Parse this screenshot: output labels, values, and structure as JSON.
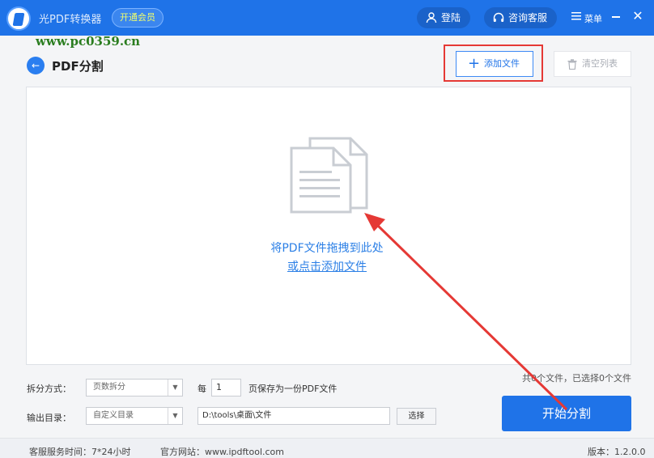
{
  "titlebar": {
    "app_title": "光PDF转换器",
    "vip_label": "开通会员",
    "login_label": "登陆",
    "service_label": "咨询客服",
    "menu_label": "菜单"
  },
  "watermark": "www.pc0359.cn",
  "page": {
    "title": "PDF分割",
    "add_file_label": "添加文件",
    "clear_list_label": "清空列表"
  },
  "drop_zone": {
    "hint": "将PDF文件拖拽到此处",
    "link": "或点击添加文件"
  },
  "file_count": "共0个文件，已选择0个文件",
  "options": {
    "split_mode_label": "拆分方式：",
    "split_mode_value": "页数拆分",
    "every_label": "每",
    "pages_value": "1",
    "pages_suffix": "页保存为一份PDF文件",
    "output_dir_label": "输出目录：",
    "output_dir_value": "自定义目录",
    "output_path": "D:\\tools\\桌面\\文件",
    "choose_label": "选择"
  },
  "start_label": "开始分割",
  "footer": {
    "service_hours": "客服服务时间：7*24小时",
    "website": "官方网站：www.ipdftool.com",
    "version": "版本：1.2.0.0"
  },
  "colors": {
    "primary": "#1f73e8",
    "highlight_box": "#e53935",
    "watermark": "#2a7d1f"
  }
}
